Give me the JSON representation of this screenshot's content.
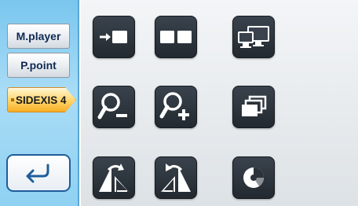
{
  "sidebar": {
    "items": [
      {
        "label": "M.player",
        "active": false
      },
      {
        "label": "P.point",
        "active": false
      },
      {
        "label": "SIDEXIS 4",
        "active": true
      }
    ],
    "back_icon": "return-arrow-icon"
  },
  "toolbar": {
    "row1": [
      "move-image-right-icon",
      "split-screen-icon",
      "multi-monitor-icon"
    ],
    "row2": [
      "zoom-out-icon",
      "zoom-in-icon",
      "window-cascade-icon"
    ],
    "row3": [
      "rotate-left-icon",
      "rotate-right-icon",
      "color-wheel-icon"
    ]
  },
  "colors": {
    "sidebar_bg": "#8fd1f2",
    "active_item": "#f6ae25",
    "tile_bg": "#2b3239",
    "icon_fg": "#ffffff"
  }
}
